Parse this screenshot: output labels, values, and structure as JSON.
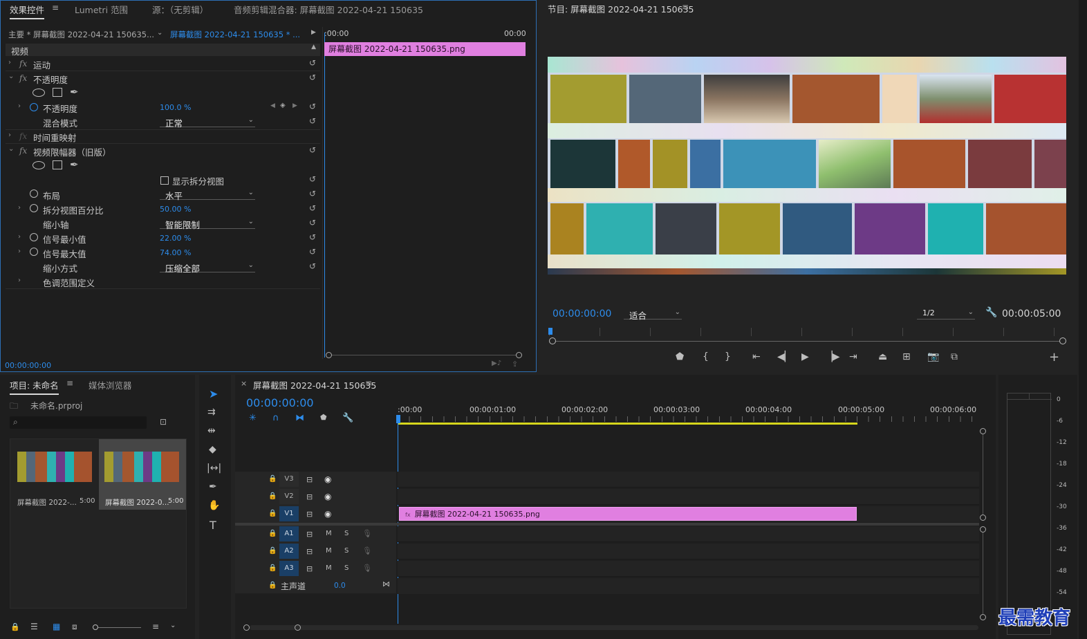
{
  "effect_controls": {
    "tabs": [
      "效果控件",
      "Lumetri 范围",
      "源：（无剪辑）",
      "音频剪辑混合器: 屏幕截图 2022-04-21 150635"
    ],
    "master_label": "主要 * 屏幕截图 2022-04-21 150635...",
    "clip_label": "屏幕截图 2022-04-21 150635 * ...",
    "section_video": "视频",
    "motion": "运动",
    "opacity_group": "不透明度",
    "opacity_label": "不透明度",
    "opacity_value": "100.0 %",
    "blend_mode_label": "混合模式",
    "blend_mode_value": "正常",
    "time_remap": "时间重映射",
    "video_limiter": "视频限幅器（旧版）",
    "show_split": "显示拆分视图",
    "layout_label": "布局",
    "layout_value": "水平",
    "split_pct_label": "拆分视图百分比",
    "split_pct_value": "50.00 %",
    "reduce_axis_label": "缩小轴",
    "reduce_axis_value": "智能限制",
    "signal_min_label": "信号最小值",
    "signal_min_value": "22.00 %",
    "signal_max_label": "信号最大值",
    "signal_max_value": "74.00 %",
    "reduce_method_label": "缩小方式",
    "reduce_method_value": "压缩全部",
    "tonal_range": "色调范围定义",
    "timecode": "00:00:00:00",
    "mini_timeline_start": ":00:00",
    "mini_timeline_end": "00:00",
    "mini_clip": "屏幕截图 2022-04-21  150635.png"
  },
  "program_monitor": {
    "title": "节目: 屏幕截图 2022-04-21 150635",
    "timecode": "00:00:00:00",
    "fit": "适合",
    "resolution": "1/2",
    "duration": "00:00:05:00"
  },
  "project": {
    "tabs": [
      "项目: 未命名",
      "媒体浏览器"
    ],
    "file": "未命名.prproj",
    "items": [
      {
        "name": "屏幕截图 2022-...",
        "duration": "5:00"
      },
      {
        "name": "屏幕截图 2022-0...",
        "duration": "5:00"
      }
    ]
  },
  "timeline": {
    "title": "屏幕截图 2022-04-21 150635",
    "timecode": "00:00:00:00",
    "ruler": [
      ":00:00",
      "00:00:01:00",
      "00:00:02:00",
      "00:00:03:00",
      "00:00:04:00",
      "00:00:05:00",
      "00:00:06:00"
    ],
    "video_tracks": [
      "V3",
      "V2",
      "V1"
    ],
    "audio_tracks": [
      "A1",
      "A2",
      "A3"
    ],
    "master": "主声道",
    "master_value": "0.0",
    "clip": "屏幕截图 2022-04-21  150635.png",
    "mute": "M",
    "solo": "S"
  },
  "meter": {
    "labels": [
      "0",
      "-6",
      "-12",
      "-18",
      "-24",
      "-30",
      "-36",
      "-42",
      "-48",
      "-54"
    ]
  },
  "watermark": "最需教育",
  "colors": {
    "accent_blue": "#2d8ceb",
    "clip_pink": "#e07fe0",
    "track_blue": "#1a3f66",
    "work_area_yellow": "#d6d61c"
  }
}
